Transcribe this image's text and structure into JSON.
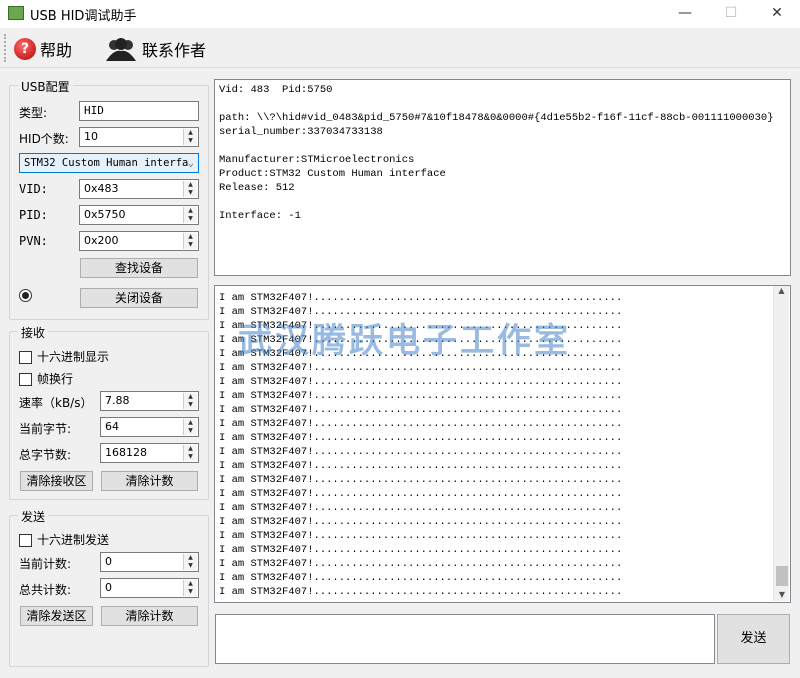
{
  "window": {
    "title": "USB HID调试助手",
    "min": "—",
    "max": "☐",
    "close": "✕"
  },
  "toolbar": {
    "help": "帮助",
    "contact": "联系作者",
    "help_icon_glyph": "?"
  },
  "usb": {
    "group": "USB配置",
    "type_label": "类型:",
    "type_value": "HID",
    "count_label": "HID个数:",
    "count_value": "10",
    "device_select": "STM32 Custom Human interfa",
    "vid_label": "VID:",
    "vid_value": "0x483",
    "pid_label": "PID:",
    "pid_value": "0x5750",
    "pvn_label": "PVN:",
    "pvn_value": "0x200",
    "find_btn": "查找设备",
    "close_btn": "关闭设备"
  },
  "recv": {
    "group": "接收",
    "hex_display": "十六进制显示",
    "frame_newline": "帧换行",
    "rate_label": "速率（kB/s）",
    "rate_value": "7.88",
    "cur_bytes_label": "当前字节:",
    "cur_bytes_value": "64",
    "total_bytes_label": "总字节数:",
    "total_bytes_value": "168128",
    "clear_area": "清除接收区",
    "clear_count": "清除计数"
  },
  "send": {
    "group": "发送",
    "hex_send": "十六进制发送",
    "cur_count_label": "当前计数:",
    "cur_count_value": "0",
    "total_count_label": "总共计数:",
    "total_count_value": "0",
    "clear_area": "清除发送区",
    "clear_count": "清除计数",
    "send_btn": "发送",
    "input_value": ""
  },
  "info": {
    "text": "Vid: 483  Pid:5750\n\npath: \\\\?\\hid#vid_0483&pid_5750#7&10f18478&0&0000#{4d1e55b2-f16f-11cf-88cb-001111000030}\nserial_number:337034733138\n\nManufacturer:STMicroelectronics\nProduct:STM32 Custom Human interface\nRelease: 512\n\nInterface: -1"
  },
  "receive_lines": [
    "I am STM32F407!.................................................",
    "I am STM32F407!.................................................",
    "I am STM32F407!.................................................",
    "I am STM32F407!.................................................",
    "I am STM32F407!.................................................",
    "I am STM32F407!.................................................",
    "I am STM32F407!.................................................",
    "I am STM32F407!.................................................",
    "I am STM32F407!.................................................",
    "I am STM32F407!.................................................",
    "I am STM32F407!.................................................",
    "I am STM32F407!.................................................",
    "I am STM32F407!.................................................",
    "I am STM32F407!.................................................",
    "I am STM32F407!.................................................",
    "I am STM32F407!.................................................",
    "I am STM32F407!.................................................",
    "I am STM32F407!.................................................",
    "I am STM32F407!.................................................",
    "I am STM32F407!.................................................",
    "I am STM32F407!.................................................",
    "I am STM32F407!................................................."
  ],
  "watermark": "武汉腾跃电子工作室"
}
